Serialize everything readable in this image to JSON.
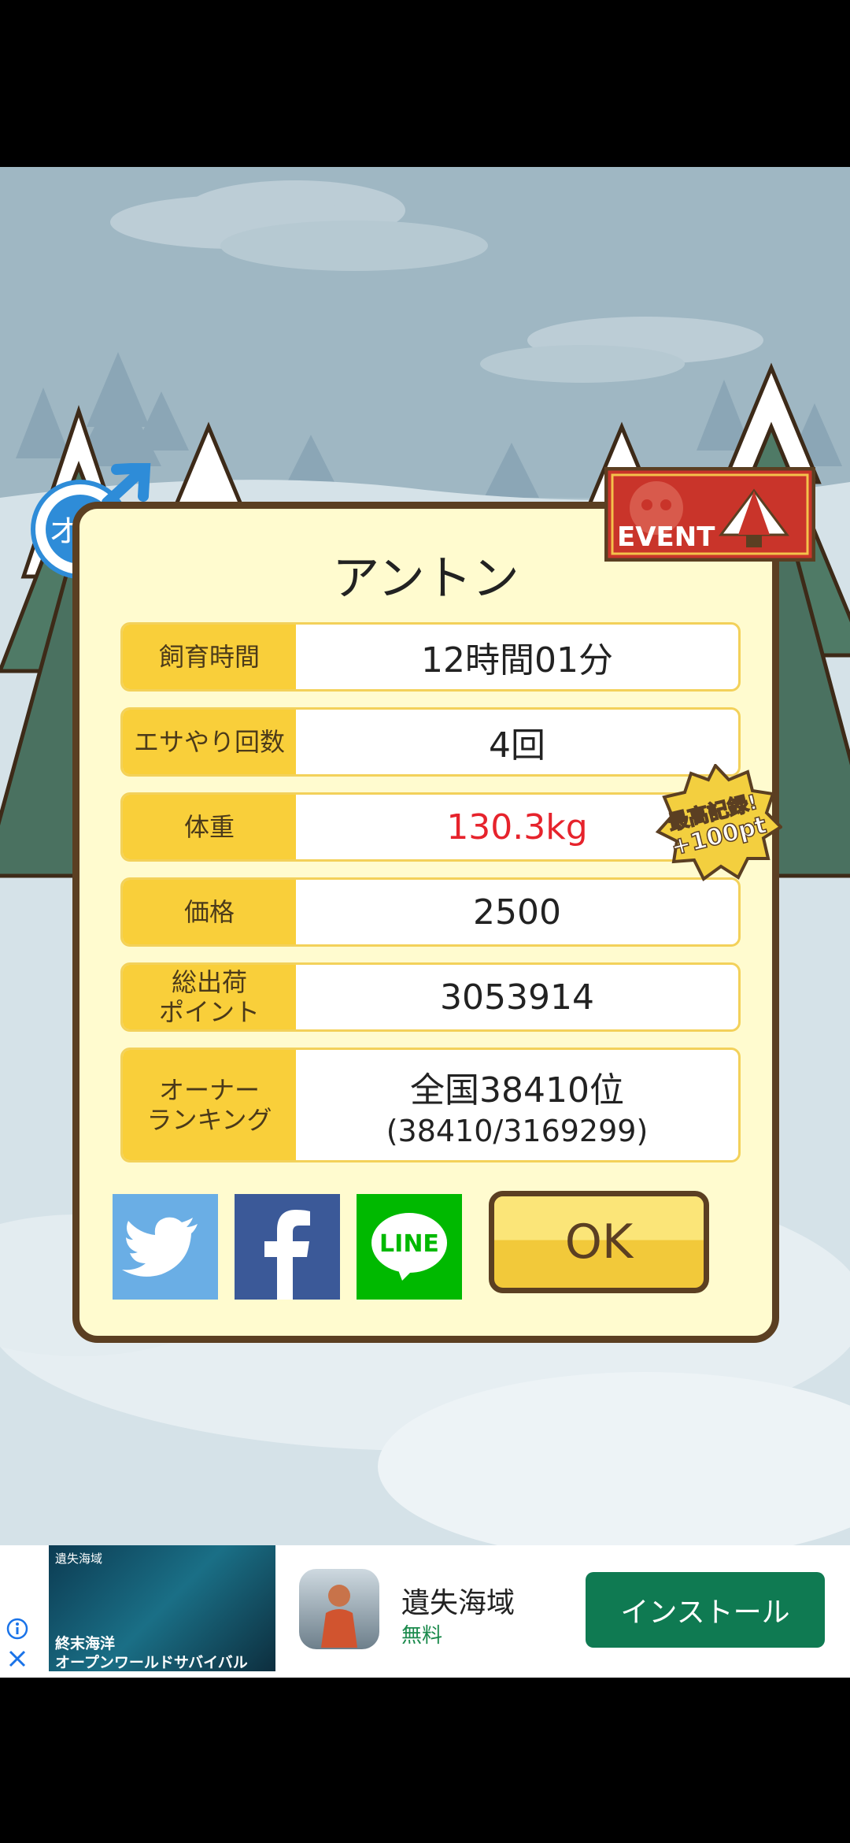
{
  "pet": {
    "gender_label": "オス",
    "name": "アントン",
    "event_label": "EVENT",
    "record_badge": {
      "line1": "最高記録!",
      "line2": "+100pt"
    }
  },
  "stats": [
    {
      "label": "飼育時間",
      "value": "12時間01分"
    },
    {
      "label": "エサやり回数",
      "value": "4回"
    },
    {
      "label": "体重",
      "value": "130.3kg",
      "value_color": "#e6232c"
    },
    {
      "label": "価格",
      "value": "2500"
    },
    {
      "label": "総出荷\nポイント",
      "value": "3053914"
    },
    {
      "label": "オーナー\nランキング",
      "value": "全国38410位",
      "sub": "(38410/3169299)"
    }
  ],
  "share": {
    "twitter_color": "#6aaee5",
    "facebook_color": "#3b5998",
    "line_color": "#00b900",
    "line_text": "LINE"
  },
  "ok_label": "OK",
  "ad": {
    "banner_tag": "遺失海域",
    "banner_line1": "終末海洋",
    "banner_line2": "オープンワールドサバイバル",
    "app_name": "遺失海域",
    "price": "無料",
    "install_label": "インストール"
  }
}
